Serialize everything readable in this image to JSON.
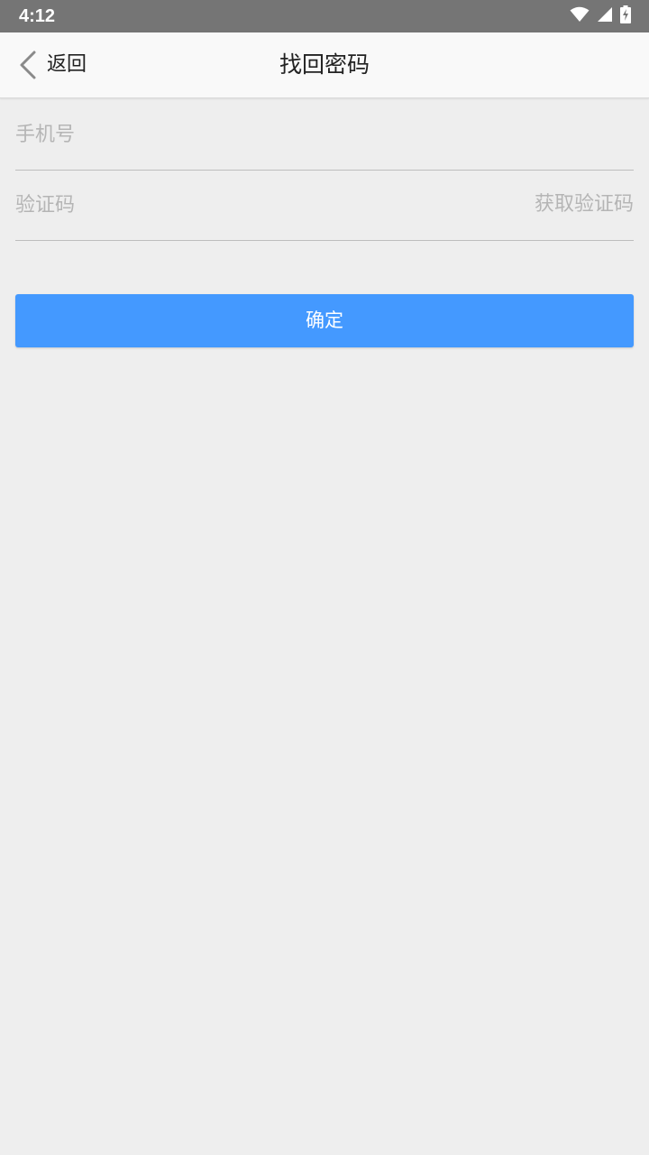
{
  "status_bar": {
    "time": "4:12",
    "icons": [
      "wifi-icon",
      "signal-icon",
      "battery-charging-icon"
    ]
  },
  "nav": {
    "back_label": "返回",
    "title": "找回密码"
  },
  "form": {
    "phone_placeholder": "手机号",
    "code_placeholder": "验证码",
    "get_code_label": "获取验证码",
    "confirm_label": "确定"
  },
  "colors": {
    "status_bar": "#757575",
    "nav_bar": "#f9f9f9",
    "background": "#eeeeee",
    "accent": "#4499ff",
    "placeholder": "#b5b5b5"
  }
}
